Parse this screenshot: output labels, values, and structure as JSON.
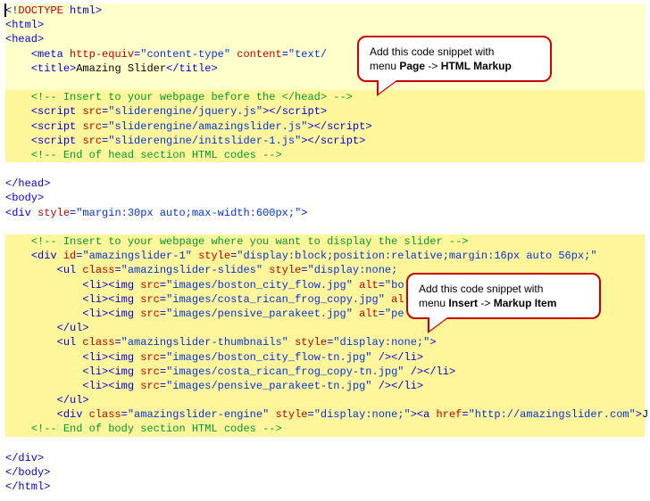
{
  "code": {
    "doctype_a": "<!",
    "doctype_b": "DOCTYPE",
    "doctype_c": " html",
    "html_open": "html",
    "head_open": "head",
    "meta_tag": "meta",
    "meta_attr1": "http-equiv",
    "meta_val1": "\"content-type\"",
    "meta_attr2": "content",
    "meta_val2": "\"text/",
    "title_open": "title",
    "title_text": "Amazing Slider",
    "title_close": "title",
    "cmt1": "<!-- Insert to your webpage before the </head> -->",
    "script_tag": "script",
    "src_attr": "src",
    "src1": "\"sliderengine/jquery.js\"",
    "src2": "\"sliderengine/amazingslider.js\"",
    "src3": "\"sliderengine/initslider-1.js\"",
    "cmt2": "<!-- End of head section HTML codes -->",
    "head_close": "head",
    "body_open": "body",
    "div_tag": "div",
    "style_attr": "style",
    "style_val_outer": "\"margin:30px auto;max-width:600px;\"",
    "cmt3": "<!-- Insert to your webpage where you want to display the slider -->",
    "id_attr": "id",
    "id_val": "\"amazingslider-1\"",
    "style_val_inner": "\"display:block;position:relative;margin:16px auto 56px;\"",
    "ul_tag": "ul",
    "class_attr": "class",
    "class_slides": "\"amazingslider-slides\"",
    "style_none": "\"display:none;",
    "style_none_full": "\"display:none;\"",
    "li_tag": "li",
    "img_tag": "img",
    "img_src1": "\"images/boston_city_flow.jpg\"",
    "img_alt": "alt",
    "alt1": "\"bo",
    "img_src2": "\"images/costa_rican_frog_copy.jpg\"",
    "alt2": "al",
    "img_src3": "\"images/pensive_parakeet.jpg\"",
    "alt3": "\"pe",
    "class_thumbs": "\"amazingslider-thumbnails\"",
    "tn1": "\"images/boston_city_flow-tn.jpg\"",
    "tn2": "\"images/costa_rican_frog_copy-tn.jpg\"",
    "tn3": "\"images/pensive_parakeet-tn.jpg\"",
    "class_engine": "\"amazingslider-engine\"",
    "a_tag": "a",
    "href_attr": "href",
    "href_val": "\"http://amazingslider.com\"",
    "a_text": "J",
    "cmt4": "<!-- End of body section HTML codes -->",
    "body_close": "body",
    "html_close": "html"
  },
  "callout1": {
    "line1": "Add this code snippet with",
    "line2a": "menu ",
    "line2b": "Page",
    "line2c": " -> ",
    "line2d": "HTML Markup"
  },
  "callout2": {
    "line1": "Add this code snippet with",
    "line2a": "menu ",
    "line2b": "Insert",
    "line2c": " -> ",
    "line2d": "Markup Item"
  }
}
